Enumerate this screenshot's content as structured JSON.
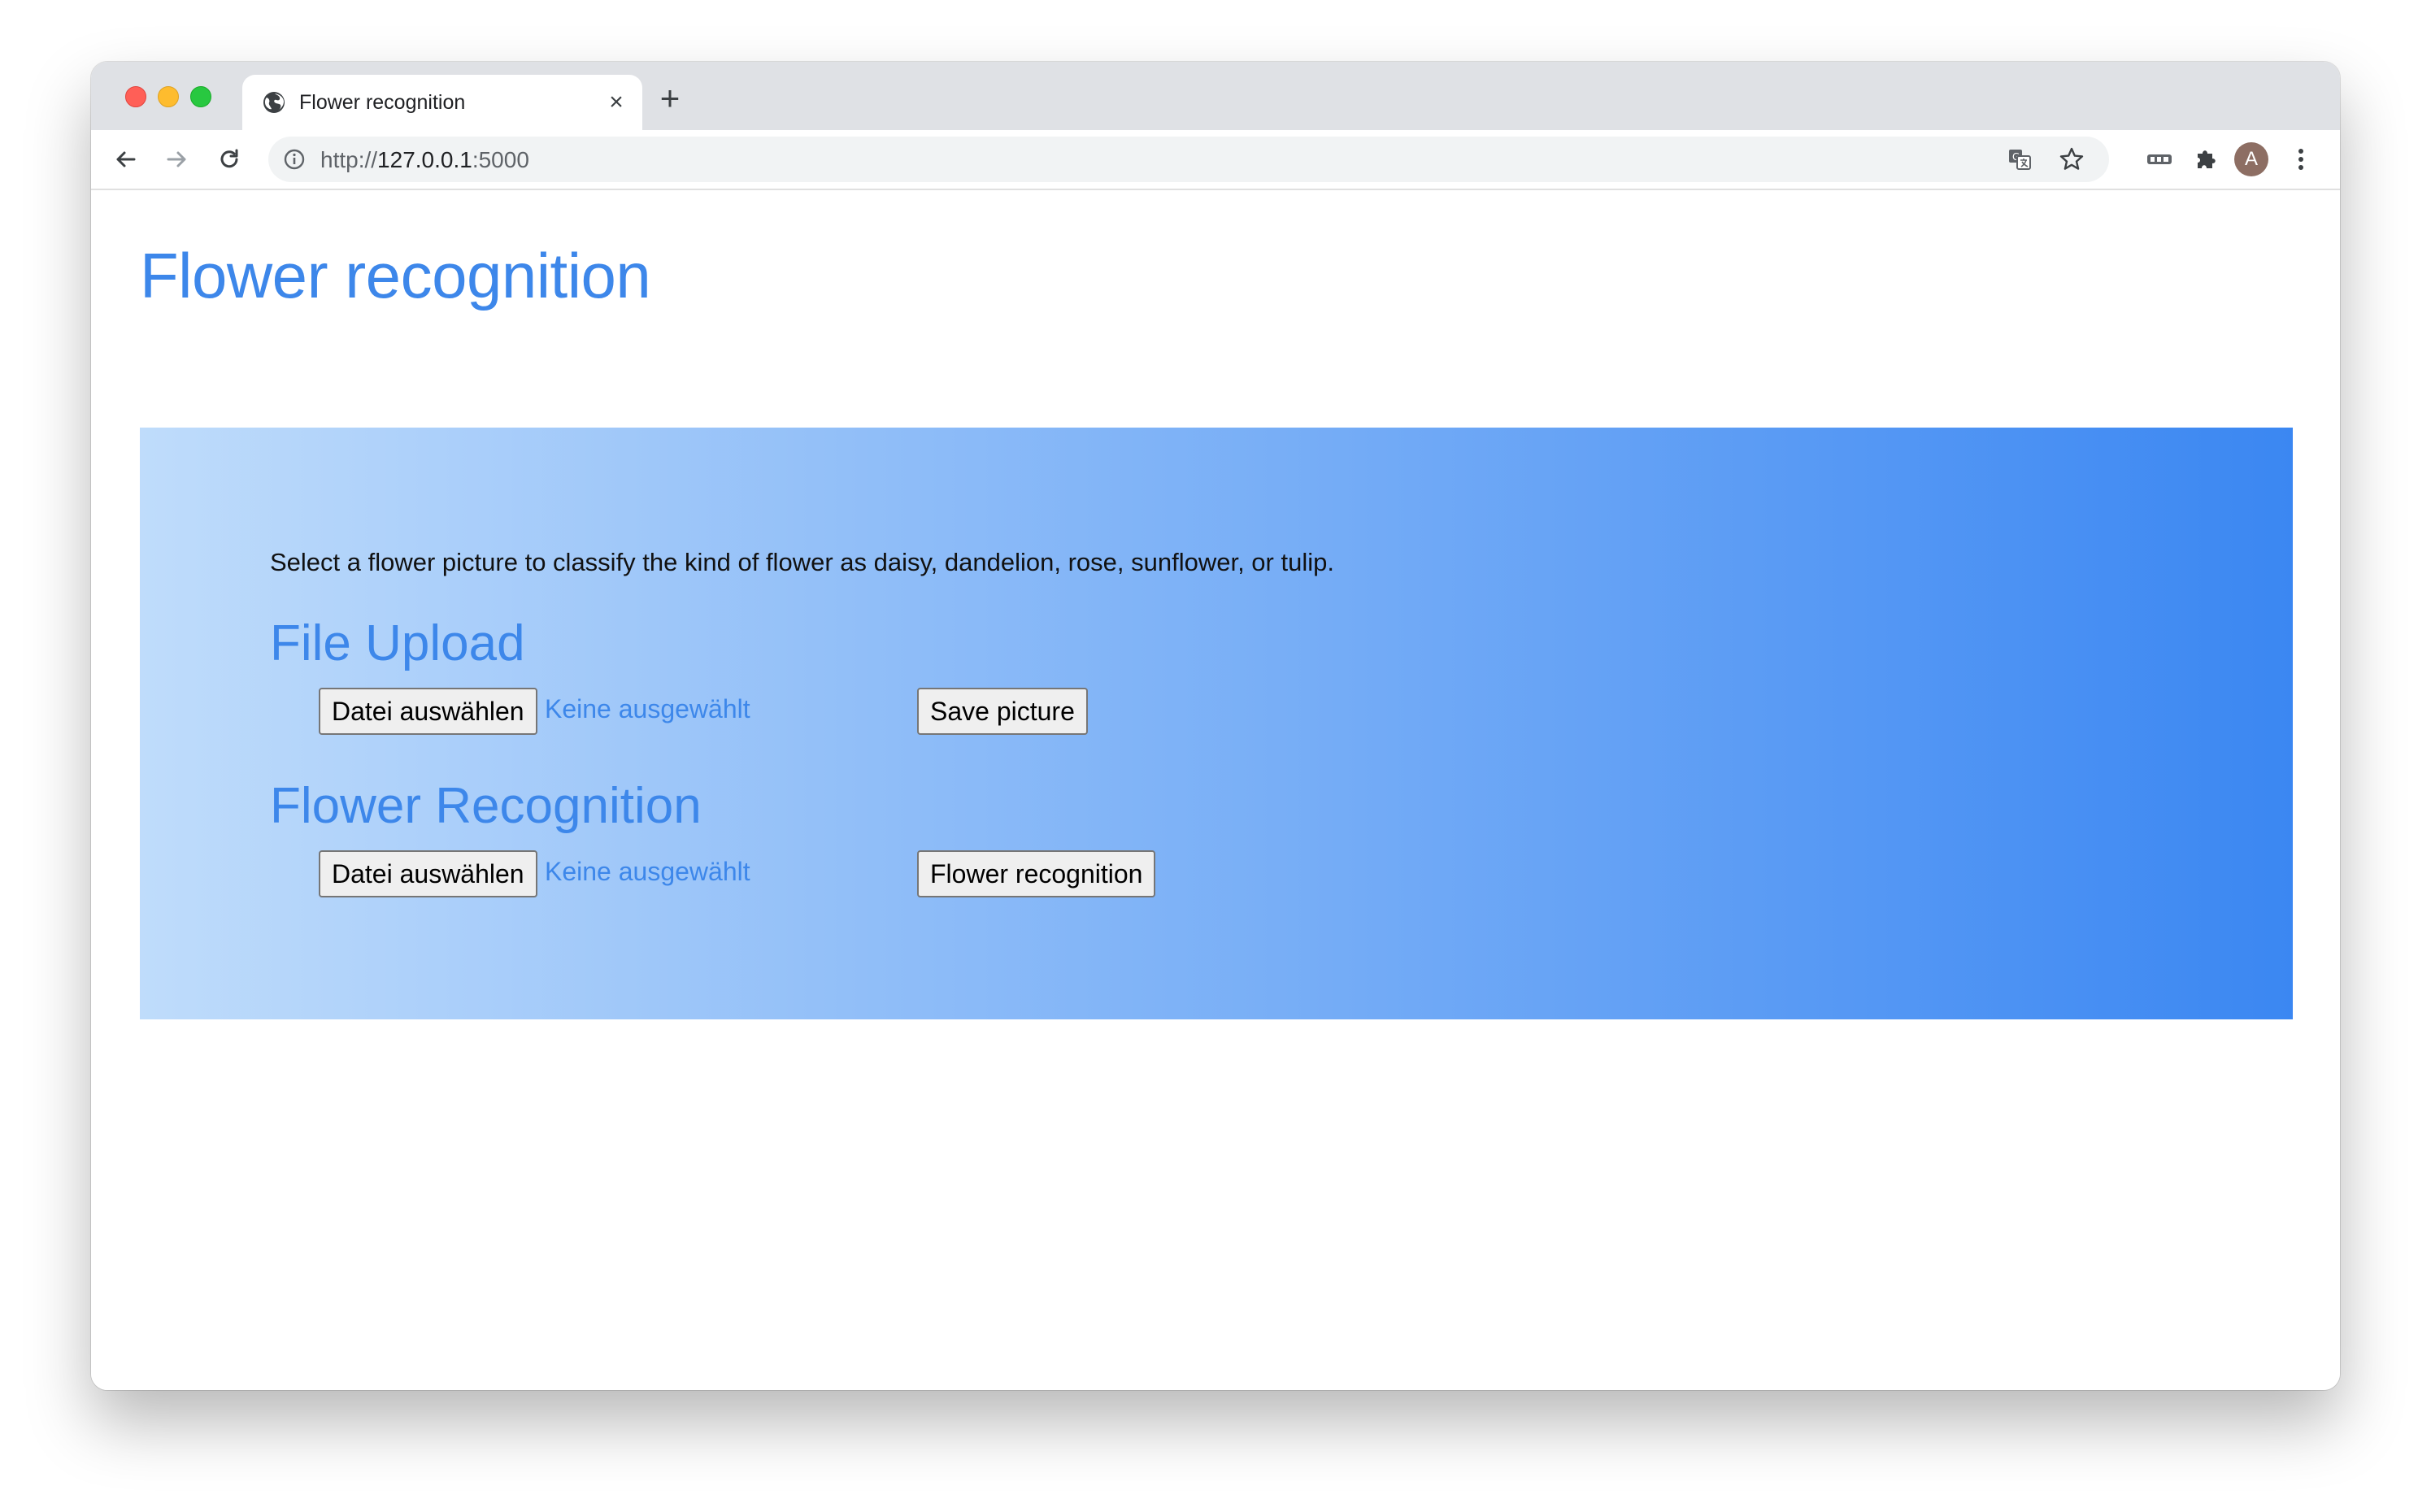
{
  "browser": {
    "tab": {
      "title": "Flower recognition",
      "close_label": "×",
      "icon": "globe-icon"
    },
    "new_tab_label": "+",
    "address_bar": {
      "url_scheme": "http://",
      "url_host": "127.0.0.1",
      "url_port": ":5000"
    },
    "profile_initial": "A"
  },
  "page": {
    "title": "Flower recognition",
    "intro": "Select a flower picture to classify the kind of flower as daisy, dandelion, rose, sunflower, or tulip.",
    "upload_section": {
      "heading": "File Upload",
      "file_button": "Datei auswählen",
      "file_status": "Keine ausgewählt",
      "action_button": "Save picture"
    },
    "recognition_section": {
      "heading": "Flower Recognition",
      "file_button": "Datei auswählen",
      "file_status": "Keine ausgewählt",
      "action_button": "Flower recognition"
    }
  },
  "colors": {
    "accent": "#3d87ea",
    "panel_gradient_start": "#bfdcfb",
    "panel_gradient_end": "#3b87f2"
  }
}
